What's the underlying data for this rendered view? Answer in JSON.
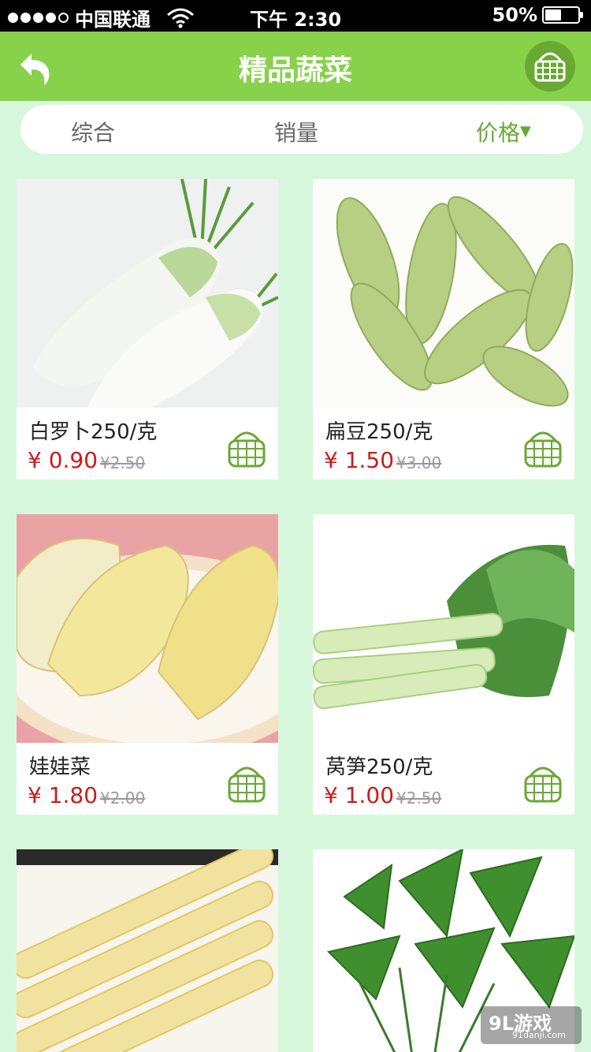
{
  "status_bar": {
    "carrier": "中国联通",
    "time": "下午 2:30",
    "battery": "50%",
    "battery_level": 0.5
  },
  "header": {
    "title": "精品蔬菜",
    "back_icon": "back-arrow-icon",
    "cart_icon": "basket-icon"
  },
  "filters": [
    {
      "label": "综合"
    },
    {
      "label": "销量"
    },
    {
      "label": "价格",
      "arrow": "▼"
    }
  ],
  "products": [
    {
      "name": "白罗卜250/克",
      "price": "¥ 0.90",
      "old_price": "¥2.50",
      "image": "white-radish"
    },
    {
      "name": "扁豆250/克",
      "price": "¥ 1.50",
      "old_price": "¥3.00",
      "image": "flat-beans"
    },
    {
      "name": "娃娃菜",
      "price": "¥ 1.80",
      "old_price": "¥2.00",
      "image": "baby-cabbage"
    },
    {
      "name": "莴笋250/克",
      "price": "¥ 1.00",
      "old_price": "¥2.50",
      "image": "celtuce"
    },
    {
      "name": "",
      "price": "",
      "old_price": "",
      "image": "bamboo-shoots"
    },
    {
      "name": "",
      "price": "",
      "old_price": "",
      "image": "sweet-potato-leaves"
    }
  ],
  "watermark": {
    "main": "9L游戏",
    "sub": "91danji.com"
  },
  "colors": {
    "header_green": "#88d14a",
    "accent_green": "#6aa834",
    "price_red": "#cc1a1a",
    "background": "#d7f7dc"
  }
}
